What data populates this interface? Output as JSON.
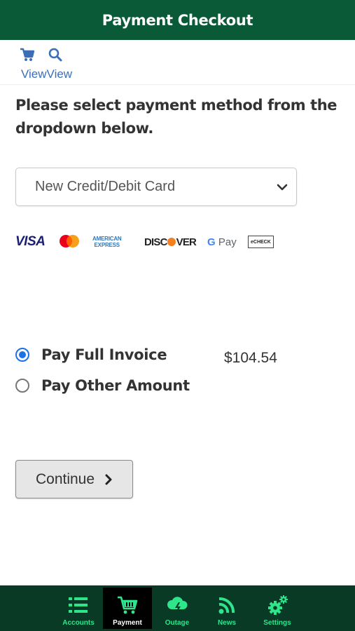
{
  "header": {
    "title": "Payment Checkout"
  },
  "toolbar": {
    "icons": [
      "cart-icon",
      "search-icon"
    ],
    "labels": [
      "View",
      "View"
    ]
  },
  "instructions": "Please select payment method from the dropdown below.",
  "payment_method": {
    "selected": "New Credit/Debit Card"
  },
  "card_logos": {
    "visa": "VISA",
    "amex": [
      "AMERICAN",
      "EXPRESS"
    ],
    "discover": [
      "DISC",
      "VER"
    ],
    "gpay": [
      "G",
      "Pay"
    ],
    "echeck": "eCHECK"
  },
  "pay_options": {
    "full_label": "Pay Full Invoice",
    "full_amount": "$104.54",
    "full_selected": true,
    "other_label": "Pay Other Amount",
    "other_selected": false
  },
  "continue_button": {
    "label": "Continue"
  },
  "bottom_nav": {
    "items": [
      {
        "label": "Accounts",
        "icon": "list-icon",
        "active": false
      },
      {
        "label": "Payment",
        "icon": "cart-icon",
        "active": true
      },
      {
        "label": "Outage",
        "icon": "storm-cloud-icon",
        "active": false
      },
      {
        "label": "News",
        "icon": "rss-icon",
        "active": false
      },
      {
        "label": "Settings",
        "icon": "gears-icon",
        "active": false
      }
    ]
  },
  "colors": {
    "header_bg": "#0a5a37",
    "nav_bg": "#083a25",
    "nav_accent": "#2ee58c",
    "link": "#3a6fb7",
    "radio_checked": "#1a73e8"
  }
}
